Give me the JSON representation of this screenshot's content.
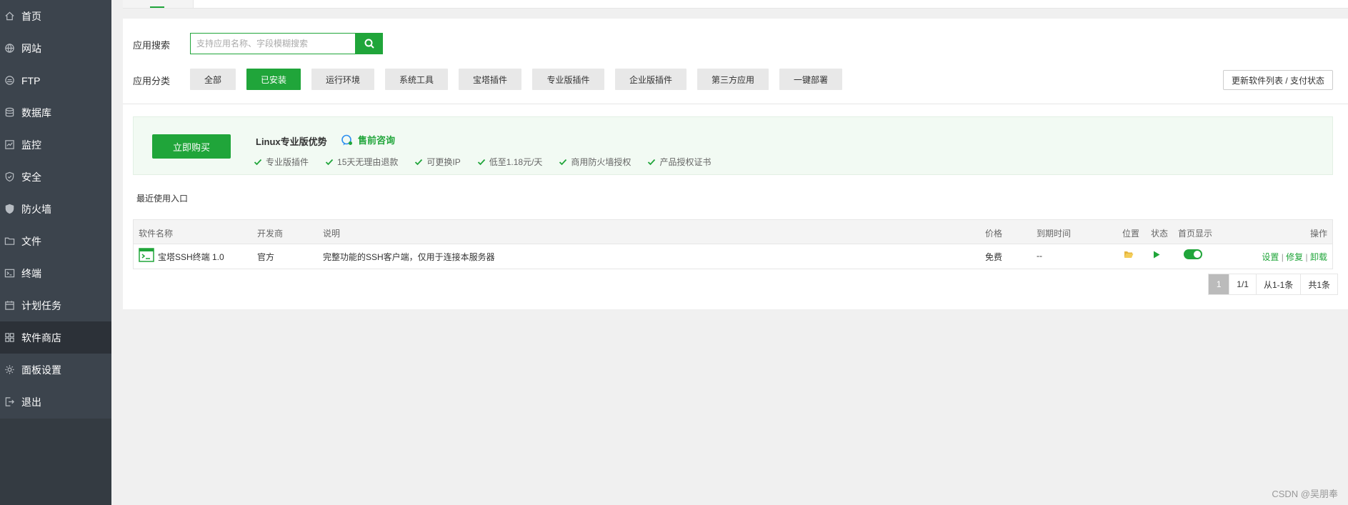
{
  "sidebar": {
    "items": [
      {
        "label": "首页",
        "icon": "home-icon"
      },
      {
        "label": "网站",
        "icon": "globe-icon"
      },
      {
        "label": "FTP",
        "icon": "ftp-icon"
      },
      {
        "label": "数据库",
        "icon": "database-icon"
      },
      {
        "label": "监控",
        "icon": "monitor-icon"
      },
      {
        "label": "安全",
        "icon": "shield-icon"
      },
      {
        "label": "防火墙",
        "icon": "firewall-icon"
      },
      {
        "label": "文件",
        "icon": "folder-icon"
      },
      {
        "label": "终端",
        "icon": "terminal-icon"
      },
      {
        "label": "计划任务",
        "icon": "calendar-icon"
      },
      {
        "label": "软件商店",
        "icon": "grid-icon",
        "active": true
      },
      {
        "label": "面板设置",
        "icon": "gear-icon"
      },
      {
        "label": "退出",
        "icon": "logout-icon"
      }
    ]
  },
  "search": {
    "label": "应用搜索",
    "placeholder": "支持应用名称、字段模糊搜索",
    "value": ""
  },
  "categories": {
    "label": "应用分类",
    "items": [
      "全部",
      "已安装",
      "运行环境",
      "系统工具",
      "宝塔插件",
      "专业版插件",
      "企业版插件",
      "第三方应用",
      "一键部署"
    ],
    "active": "已安装"
  },
  "update_button": "更新软件列表 / 支付状态",
  "promo": {
    "buy_label": "立即购买",
    "title": "Linux专业版优势",
    "consult_label": "售前咨询",
    "features": [
      "专业版插件",
      "15天无理由退款",
      "可更换IP",
      "低至1.18元/天",
      "商用防火墙授权",
      "产品授权证书"
    ]
  },
  "recent_label": "最近使用入口",
  "table": {
    "headers": {
      "name": "软件名称",
      "developer": "开发商",
      "desc": "说明",
      "price": "价格",
      "expire": "到期时间",
      "location": "位置",
      "status": "状态",
      "homepage": "首页显示",
      "ops": "操作"
    },
    "rows": [
      {
        "name": "宝塔SSH终端 1.0",
        "developer": "官方",
        "desc": "完整功能的SSH客户端，仅用于连接本服务器",
        "price": "免费",
        "expire": "--",
        "homepage_display": true,
        "ops": [
          "设置",
          "修复",
          "卸载"
        ]
      }
    ]
  },
  "pagination": {
    "current": "1",
    "pages": "1/1",
    "range": "从1-1条",
    "total": "共1条"
  },
  "watermark": "CSDN @吴朋奉",
  "colors": {
    "accent": "#20a53a",
    "sidebar_bg": "#3c444d",
    "sidebar_active": "#2c3138"
  }
}
